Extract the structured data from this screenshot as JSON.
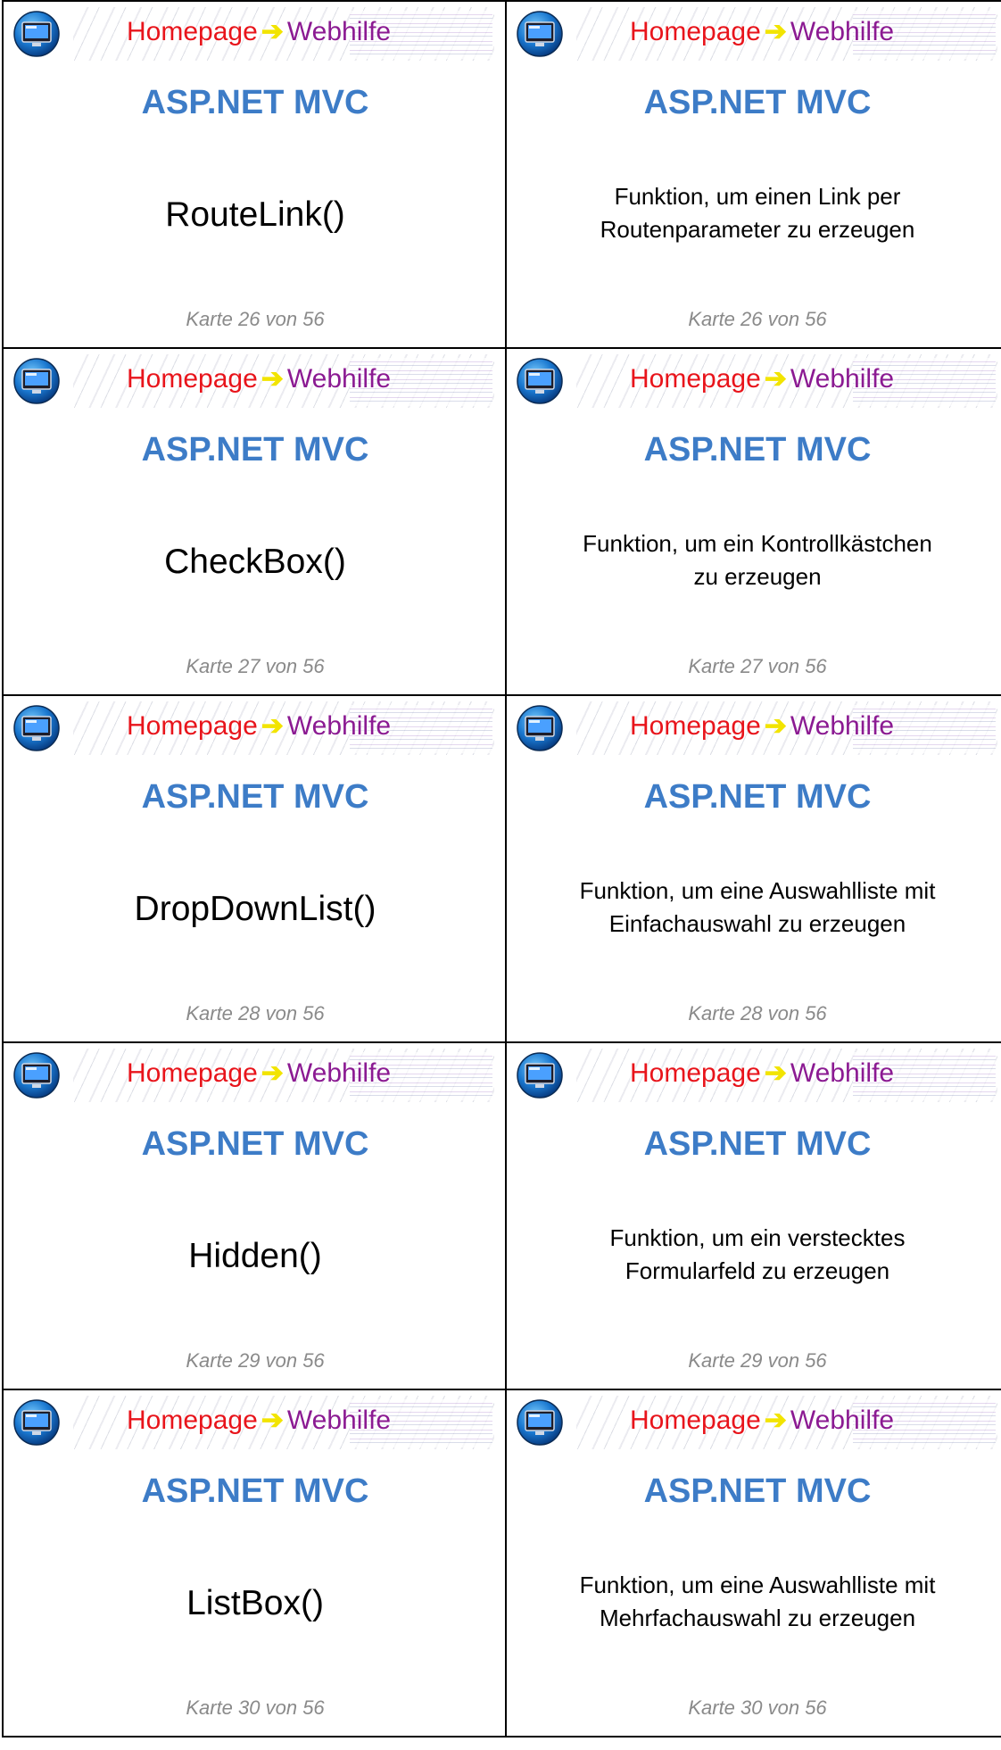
{
  "banner": {
    "home_label": "Homepage",
    "web_label": "Webhilfe",
    "logo_icon": "globe-monitor-icon",
    "colors": {
      "home": "#e8141b",
      "web": "#8b1a92",
      "arrow": "#f2e400"
    }
  },
  "subject": "ASP.NET MVC",
  "subject_color": "#3d7cc7",
  "cards": [
    {
      "front": {
        "term": "RouteLink()",
        "counter": "Karte 26 von 56"
      },
      "back": {
        "line1": "Funktion, um einen Link per",
        "line2": "Routenparameter zu erzeugen",
        "counter": "Karte 26 von 56"
      }
    },
    {
      "front": {
        "term": "CheckBox()",
        "counter": "Karte 27 von 56"
      },
      "back": {
        "line1": "Funktion, um ein Kontrollkästchen",
        "line2": "zu erzeugen",
        "counter": "Karte 27 von 56"
      }
    },
    {
      "front": {
        "term": "DropDownList()",
        "counter": "Karte 28 von 56"
      },
      "back": {
        "line1": "Funktion, um eine Auswahlliste mit",
        "line2": "Einfachauswahl zu erzeugen",
        "counter": "Karte 28 von 56"
      }
    },
    {
      "front": {
        "term": "Hidden()",
        "counter": "Karte 29 von 56"
      },
      "back": {
        "line1": "Funktion, um ein verstecktes",
        "line2": "Formularfeld zu erzeugen",
        "counter": "Karte 29 von 56"
      }
    },
    {
      "front": {
        "term": "ListBox()",
        "counter": "Karte 30 von 56"
      },
      "back": {
        "line1": "Funktion, um eine Auswahlliste mit",
        "line2": "Mehrfachauswahl zu erzeugen",
        "counter": "Karte 30 von 56"
      }
    }
  ]
}
